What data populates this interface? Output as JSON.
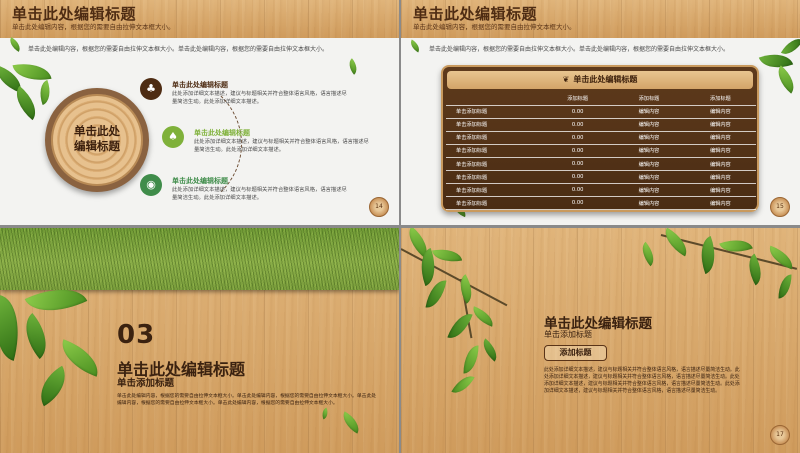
{
  "slide1": {
    "title": "单击此处编辑标题",
    "subtitle": "单击此处编辑内容，根据您的需要自由拉伸文本框大小。",
    "intro": "单击此处编辑内容，根据您的需要自由拉伸文本框大小。单击此处编辑内容，根据您的需要自由拉伸文本框大小。",
    "stump_text": "单击此处\n编辑标题",
    "items": [
      {
        "title": "单击此处编辑标题",
        "desc": "此处添加详细文本描述，建议与标题相关并符合整体语言风格，语言描述尽量简洁生动。此处添加详细文本描述。",
        "color": "#4e2c13",
        "icon": "tree-icon"
      },
      {
        "title": "单击此处编辑标题",
        "desc": "此处添加详细文本描述，建议与标题相关并符合整体语言风格，语言描述尽量简洁生动。此处添加详细文本描述。",
        "color": "#7fb13a",
        "icon": "sprout-icon"
      },
      {
        "title": "单击此处编辑标题",
        "desc": "此处添加详细文本描述，建议与标题相关并符合整体语言风格，语言描述尽量简洁生动。此处添加详细文本描述。",
        "color": "#3f8c4a",
        "icon": "bulb-icon"
      }
    ],
    "page": "14"
  },
  "slide2": {
    "title": "单击此处编辑标题",
    "subtitle": "单击此处编辑内容，根据您的需要自由拉伸文本框大小。",
    "intro": "单击此处编辑内容，根据您的需要自由拉伸文本框大小。单击此处编辑内容，根据您的需要自由拉伸文本框大小。",
    "board_title": "单击此处编辑标题",
    "rows": [
      [
        "",
        "添加标题",
        "添加标题",
        "添加标题"
      ],
      [
        "单击添加标题",
        "0.00",
        "编辑内容",
        "编辑内容"
      ],
      [
        "单击添加标题",
        "0.00",
        "编辑内容",
        "编辑内容"
      ],
      [
        "单击添加标题",
        "0.00",
        "编辑内容",
        "编辑内容"
      ],
      [
        "单击添加标题",
        "0.00",
        "编辑内容",
        "编辑内容"
      ],
      [
        "单击添加标题",
        "0.00",
        "编辑内容",
        "编辑内容"
      ],
      [
        "单击添加标题",
        "0.00",
        "编辑内容",
        "编辑内容"
      ],
      [
        "单击添加标题",
        "0.00",
        "编辑内容",
        "编辑内容"
      ],
      [
        "单击添加标题",
        "0.00",
        "编辑内容",
        "编辑内容"
      ]
    ],
    "page": "15"
  },
  "slide3": {
    "number": "03",
    "title": "单击此处编辑标题",
    "subtitle": "单击添加标题",
    "body": "单击此处编辑内容，根据您的需要自由拉伸文本框大小。单击此处编辑内容，根据您的需要自由拉伸文本框大小。单击此处编辑内容，根据您的需要自由拉伸文本框大小。单击此处编辑内容，根据您的需要自由拉伸文本框大小。"
  },
  "slide4": {
    "title": "单击此处编辑标题",
    "subtitle": "单击添加标题",
    "button": "添加标题",
    "body": "此处添加详细文本描述，建议与标题相关并符合整体语言风格，语言描述尽量简洁生动。此处添加详细文本描述，建议与标题相关并符合整体语言风格，语言描述尽量简洁生动。此处添加详细文本描述，建议与标题相关并符合整体语言风格，语言描述尽量简洁生动。此处添加详细文本描述，建议与标题相关并符合整体语言风格，语言描述尽量简洁生动。",
    "page": "17"
  }
}
